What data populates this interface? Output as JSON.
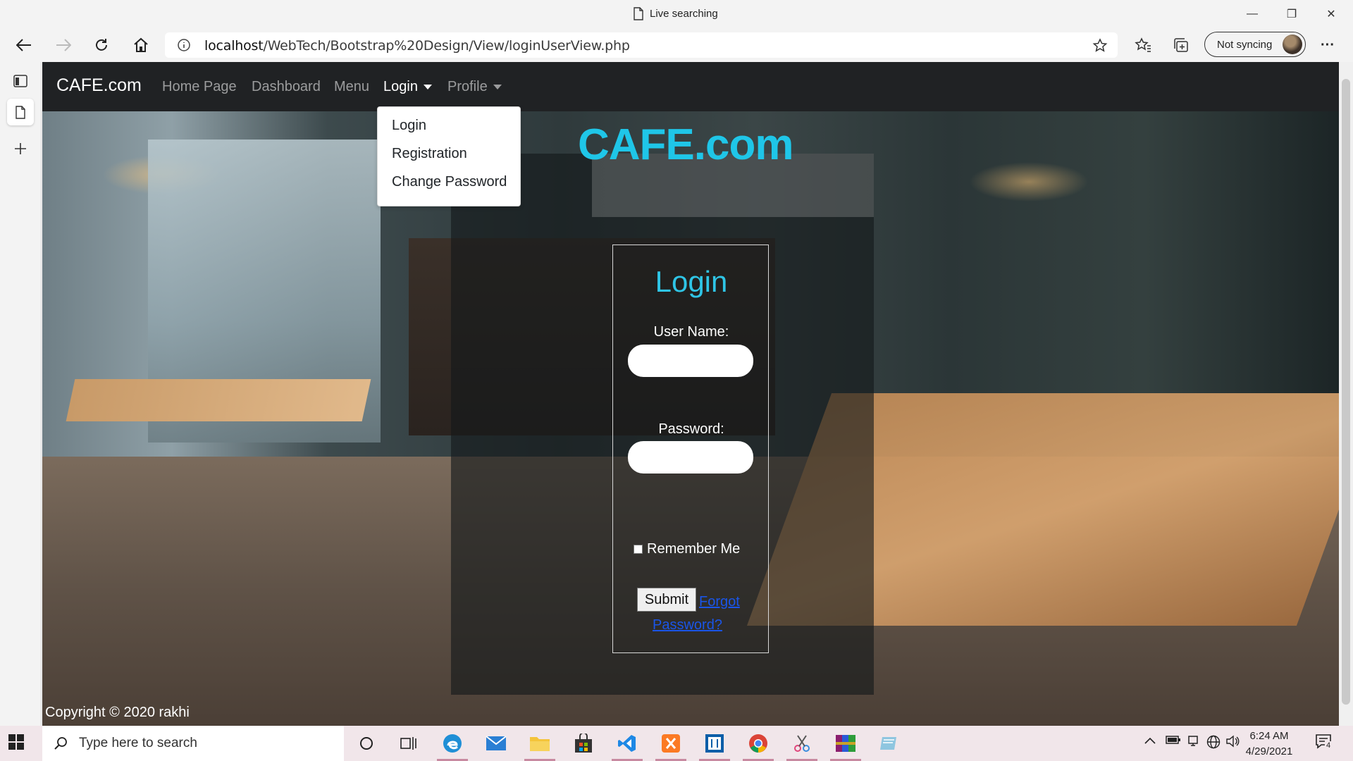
{
  "browser": {
    "tab_title": "Live searching",
    "address_host": "localhost",
    "address_path": "/WebTech/Bootstrap%20Design/View/loginUserView.php",
    "sync_label": "Not syncing",
    "minimize": "—",
    "restore": "❐",
    "close": "✕",
    "more": "···"
  },
  "navbar": {
    "brand": "CAFE.com",
    "links": [
      "Home Page",
      "Dashboard",
      "Menu",
      "Login",
      "Profile"
    ]
  },
  "dropdown": {
    "items": [
      "Login",
      "Registration",
      "Change Password"
    ]
  },
  "hero": {
    "title": "CAFE.com"
  },
  "login": {
    "heading": "Login",
    "username_label": "User Name:",
    "username_value": "",
    "password_label": "Password:",
    "password_value": "",
    "remember_label": "Remember Me",
    "submit_label": "Submit",
    "forgot_label": "Forgot Password?"
  },
  "footer": {
    "text": "Copyright © 2020 rakhi"
  },
  "taskbar": {
    "search_placeholder": "Type here to search",
    "time": "6:24 AM",
    "date": "4/29/2021",
    "notification_count": "4"
  },
  "colors": {
    "accent_cyan": "#1fc6e8",
    "navbar_bg": "#202224",
    "link_blue": "#1a55e8"
  }
}
